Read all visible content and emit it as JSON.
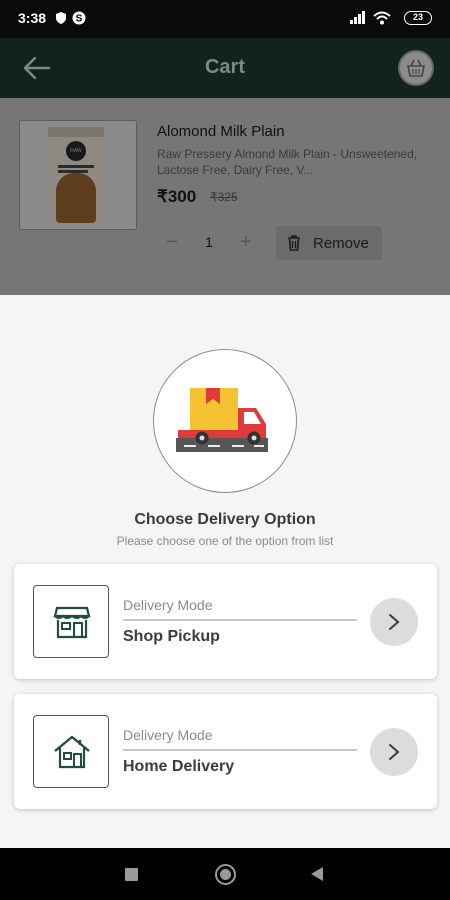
{
  "status_bar": {
    "time": "3:38",
    "battery": "23"
  },
  "app_bar": {
    "title": "Cart"
  },
  "cart_item": {
    "name": "Alomond Milk Plain",
    "description": "Raw Pressery Almond Milk Plain - Unsweetened, Lactose Free, Dairy Free, V...",
    "price": "₹300",
    "mrp": "₹325",
    "quantity": "1",
    "minus": "−",
    "plus": "+",
    "remove_label": "Remove",
    "carton_logo": "RAW"
  },
  "delivery_sheet": {
    "title": "Choose Delivery Option",
    "subtitle": "Please choose one of the option from list",
    "options": [
      {
        "label": "Delivery Mode",
        "value": "Shop Pickup",
        "icon": "store-icon"
      },
      {
        "label": "Delivery Mode",
        "value": "Home Delivery",
        "icon": "house-icon"
      }
    ]
  },
  "colors": {
    "app_bar": "#11231b",
    "truck_red": "#e03b3b",
    "box_yellow": "#f5c234",
    "road": "#555555",
    "icon_green": "#1f4e3a"
  }
}
